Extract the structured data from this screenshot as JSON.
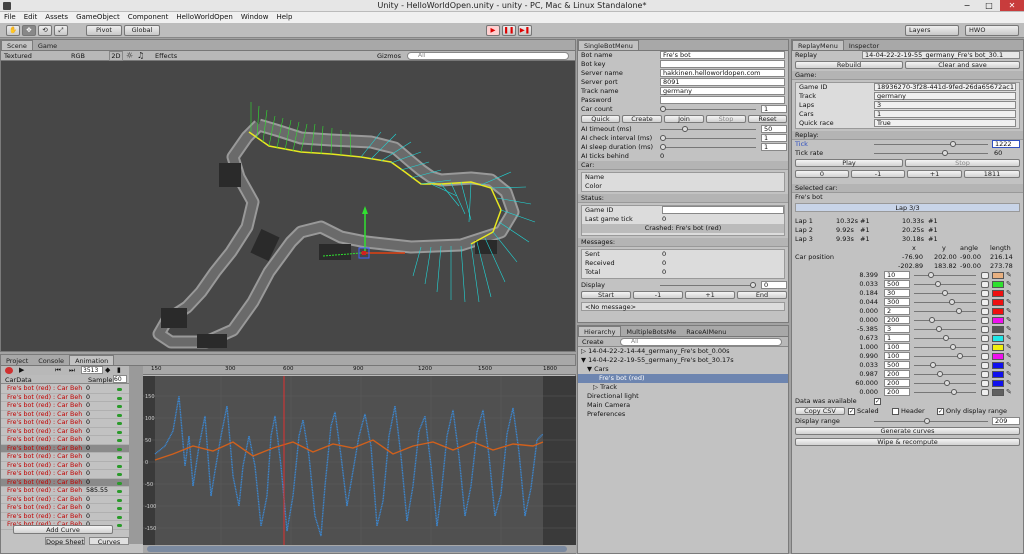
{
  "window": {
    "title": "Unity - HelloWorldOpen.unity - unity - PC, Mac & Linux Standalone*",
    "minimize": "−",
    "maximize": "□",
    "close": "✕"
  },
  "menu": [
    "File",
    "Edit",
    "Assets",
    "GameObject",
    "Component",
    "HelloWorldOpen",
    "Window",
    "Help"
  ],
  "toolbar": {
    "tools": [
      "✋",
      "✥",
      "⟲",
      "⤢"
    ],
    "pivot": "Pivot",
    "global": "Global",
    "play": "▶",
    "pause": "❚❚",
    "step": "▶❚",
    "layers": "Layers",
    "layout": "HWO"
  },
  "scene": {
    "tabs": [
      "Scene",
      "Game"
    ],
    "shading": "Textured",
    "render": "RGB",
    "mode2d": "2D",
    "effects": "Effects",
    "gizmos": "Gizmos",
    "search_placeholder": "All"
  },
  "animation": {
    "tabs": [
      "Project",
      "Console",
      "Animation"
    ],
    "frame": "3513",
    "clip": "CarData",
    "sample_label": "Sample",
    "sample": "60",
    "ruler": [
      "150",
      "300",
      "450",
      "600",
      "750",
      "900",
      "1050",
      "1200",
      "1350",
      "1500",
      "1650",
      "1800"
    ],
    "yticks": [
      "150",
      "100",
      "50",
      "0",
      "-50",
      "-100",
      "-150"
    ],
    "rows": [
      {
        "name": "Fre's bot (red) : Car Beh",
        "value": "0"
      },
      {
        "name": "Fre's bot (red) : Car Beh",
        "value": "0"
      },
      {
        "name": "Fre's bot (red) : Car Beh",
        "value": "0"
      },
      {
        "name": "Fre's bot (red) : Car Beh",
        "value": "0"
      },
      {
        "name": "Fre's bot (red) : Car Beh",
        "value": "0"
      },
      {
        "name": "Fre's bot (red) : Car Beh",
        "value": "0"
      },
      {
        "name": "Fre's bot (red) : Car Beh",
        "value": "0"
      },
      {
        "name": "Fre's bot (red) : Car Beh",
        "value": "0"
      },
      {
        "name": "Fre's bot (red) : Car Beh",
        "value": "0"
      },
      {
        "name": "Fre's bot (red) : Car Beh",
        "value": "0"
      },
      {
        "name": "Fre's bot (red) : Car Beh",
        "value": "0"
      },
      {
        "name": "Fre's bot (red) : Car Beh",
        "value": "0"
      },
      {
        "name": "Fre's bot (red) : Car Beh",
        "value": "585.55"
      },
      {
        "name": "Fre's bot (red) : Car Beh",
        "value": "0"
      },
      {
        "name": "Fre's bot (red) : Car Beh",
        "value": "0"
      },
      {
        "name": "Fre's bot (red) : Car Beh",
        "value": "0"
      },
      {
        "name": "Fre's bot (red) : Car Beh",
        "value": "0"
      }
    ],
    "add_curve": "Add Curve",
    "bottom_tabs": [
      "Dope Sheet",
      "Curves"
    ]
  },
  "single_bot_menu": {
    "tab": "SingleBotMenu",
    "fields": [
      {
        "label": "Bot name",
        "value": "Fre's bot"
      },
      {
        "label": "Bot key",
        "value": ""
      },
      {
        "label": "Server name",
        "value": "hakkinen.helloworldopen.com"
      },
      {
        "label": "Server port",
        "value": "8091"
      },
      {
        "label": "Track name",
        "value": "germany"
      },
      {
        "label": "Password",
        "value": ""
      }
    ],
    "car_count_label": "Car count",
    "car_count": "1",
    "buttons": [
      "Quick",
      "Create",
      "Join",
      "Stop",
      "Reset"
    ],
    "ai_timeout_label": "AI timeout (ms)",
    "ai_timeout": "50",
    "ai_check_label": "AI check interval (ms)",
    "ai_check": "1",
    "ai_sleep_label": "AI sleep duration (ms)",
    "ai_sleep": "1",
    "ai_ticks_label": "AI ticks behind",
    "ai_ticks": "0",
    "car_section": "Car:",
    "car_name": "Name",
    "car_color": "Color",
    "status_section": "Status:",
    "game_id_label": "Game ID",
    "last_tick_label": "Last game tick",
    "last_tick": "0",
    "crashed": "Crashed: Fre's bot (red)",
    "messages_section": "Messages:",
    "sent_label": "Sent",
    "sent": "0",
    "received_label": "Received",
    "received": "0",
    "total_label": "Total",
    "total": "0",
    "display_label": "Display",
    "display": "0",
    "nav": [
      "Start",
      "-1",
      "+1",
      "End"
    ],
    "no_message": "<No message>"
  },
  "hierarchy": {
    "tabs": [
      "Hierarchy",
      "MultipleBotsMe",
      "RaceAIMenu"
    ],
    "create": "Create",
    "search_placeholder": "All",
    "items": [
      {
        "text": "▷ 14-04-22-2-14-44_germany_Fre's bot_0.00s",
        "indent": 0
      },
      {
        "text": "▼ 14-04-22-2-19-55_germany_Fre's bot_30.17s",
        "indent": 0
      },
      {
        "text": "▼ Cars",
        "indent": 1
      },
      {
        "text": "Fre's bot (red)",
        "indent": 3
      },
      {
        "text": "▷ Track",
        "indent": 2
      },
      {
        "text": "Directional light",
        "indent": 1
      },
      {
        "text": "Main Camera",
        "indent": 1
      },
      {
        "text": "Preferences",
        "indent": 1
      }
    ]
  },
  "replay_menu": {
    "tabs": [
      "ReplayMenu",
      "Inspector"
    ],
    "replay_label": "Replay",
    "replay_value": "14-04-22-2-19-55_germany_Fre's bot_30.1",
    "rebuild": "Rebuild",
    "clear_save": "Clear and save",
    "game_section": "Game:",
    "game_fields": [
      {
        "label": "Game ID",
        "value": "18936270-3f28-441d-9fed-26da65672ac1"
      },
      {
        "label": "Track",
        "value": "germany"
      },
      {
        "label": "Laps",
        "value": "3"
      },
      {
        "label": "Cars",
        "value": "1"
      },
      {
        "label": "Quick race",
        "value": "True"
      }
    ],
    "replay_section": "Replay:",
    "tick_label": "Tick",
    "tick": "1222",
    "tick_rate_label": "Tick rate",
    "tick_rate": "60",
    "play": "Play",
    "stop": "Stop",
    "nav": [
      "0",
      "-1",
      "+1",
      "1811"
    ],
    "selected_section": "Selected car:",
    "car_name": "Fre's bot",
    "lap_progress": "Lap 3/3",
    "laps": [
      {
        "lap": "Lap 1",
        "time": "10.32s",
        "pos": "#1",
        "total": "10.33s",
        "tpos": "#1"
      },
      {
        "lap": "Lap 2",
        "time": "9.92s",
        "pos": "#1",
        "total": "20.25s",
        "tpos": "#1"
      },
      {
        "lap": "Lap 3",
        "time": "9.93s",
        "pos": "#1",
        "total": "30.18s",
        "tpos": "#1"
      }
    ],
    "pos_headers": [
      "x",
      "y",
      "angle",
      "length"
    ],
    "car_position_label": "Car position",
    "car_position": [
      "-76.90",
      "202.00",
      "-90.00",
      "216.14"
    ],
    "car_position2": [
      "-202.89",
      "183.82",
      "-90.00",
      "273.78"
    ],
    "curves": [
      {
        "value": "8.399",
        "scale": "10",
        "color": "#e8b080"
      },
      {
        "value": "0.033",
        "scale": "500",
        "color": "#30e030"
      },
      {
        "value": "0.184",
        "scale": "30",
        "color": "#ee1010"
      },
      {
        "value": "0.044",
        "scale": "300",
        "color": "#ee1010"
      },
      {
        "value": "0.000",
        "scale": "2",
        "color": "#ee1010"
      },
      {
        "value": "0.000",
        "scale": "200",
        "color": "#ee10ee"
      },
      {
        "value": "-5.385",
        "scale": "3",
        "color": "#555555"
      },
      {
        "value": "0.673",
        "scale": "1",
        "color": "#20e8e8"
      },
      {
        "value": "1.000",
        "scale": "100",
        "color": "#f0f010"
      },
      {
        "value": "0.990",
        "scale": "100",
        "color": "#ee10ee"
      },
      {
        "value": "0.033",
        "scale": "500",
        "color": "#1010ee"
      },
      {
        "value": "0.987",
        "scale": "200",
        "color": "#1010ee"
      },
      {
        "value": "60.000",
        "scale": "200",
        "color": "#1010ee"
      },
      {
        "value": "0.000",
        "scale": "200",
        "color": "#606060"
      }
    ],
    "data_available": "Data was available",
    "copy_csv": "Copy CSV",
    "scaled": "Scaled",
    "header": "Header",
    "only_display": "Only display range",
    "display_range_label": "Display range",
    "display_range": "209",
    "generate": "Generate curves",
    "wipe": "Wipe & recompute"
  }
}
